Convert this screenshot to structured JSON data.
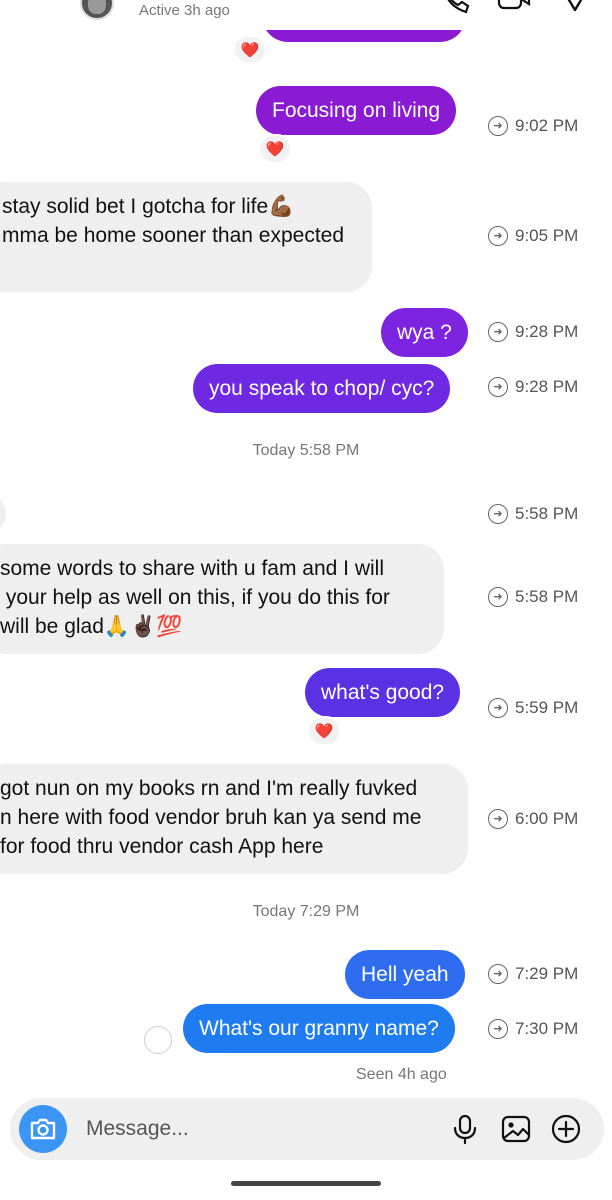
{
  "header": {
    "active_status": "Active 3h ago",
    "icons": [
      "back-arrow-icon",
      "avatar",
      "phone-icon",
      "video-icon",
      "heart-icon"
    ]
  },
  "colors": {
    "purple_dark": "#8a1bd2",
    "purple_mid": "#7c24e0",
    "indigo": "#5b32e3",
    "blue": "#2f6df0",
    "blue_bright": "#1f7cf0",
    "incoming_bg": "#efefef",
    "reaction_heart": "#e3173e"
  },
  "messages": [
    {
      "from": "me",
      "text": "Focusing on living",
      "time": "9:02 PM",
      "reaction": "❤️"
    },
    {
      "from": "them",
      "lines": [
        "stay solid bet I gotcha for life💪🏾",
        "mma be home sooner than expected"
      ],
      "time": "9:05 PM"
    },
    {
      "from": "me",
      "text": "wya ?",
      "time": "9:28 PM"
    },
    {
      "from": "me",
      "text": "you speak to chop/ cyc?",
      "time": "9:28 PM"
    },
    {
      "from": "them",
      "lines": [
        ""
      ],
      "time": "5:58 PM"
    },
    {
      "from": "them",
      "lines": [
        "some words to share with u fam and I will",
        " your help as well on this, if you do this for",
        "will be glad🙏✌🏿💯"
      ],
      "time": "5:58 PM"
    },
    {
      "from": "me",
      "text": "what's good?",
      "time": "5:59 PM",
      "reaction": "❤️"
    },
    {
      "from": "them",
      "lines": [
        "got nun on my books rn and I'm really fuvked",
        "n here with food vendor bruh kan ya send me",
        "for food thru vendor cash App here"
      ],
      "time": "6:00 PM"
    },
    {
      "from": "me",
      "text": "Hell yeah",
      "time": "7:29 PM"
    },
    {
      "from": "me",
      "text": "What's our granny name?",
      "time": "7:30 PM"
    }
  ],
  "top_reaction": "❤️",
  "day_separators": [
    "Today 5:58 PM",
    "Today 7:29 PM"
  ],
  "seen_text": "Seen 4h ago",
  "composer": {
    "placeholder": "Message...",
    "icons": [
      "camera-icon",
      "microphone-icon",
      "gallery-icon",
      "add-icon"
    ]
  }
}
